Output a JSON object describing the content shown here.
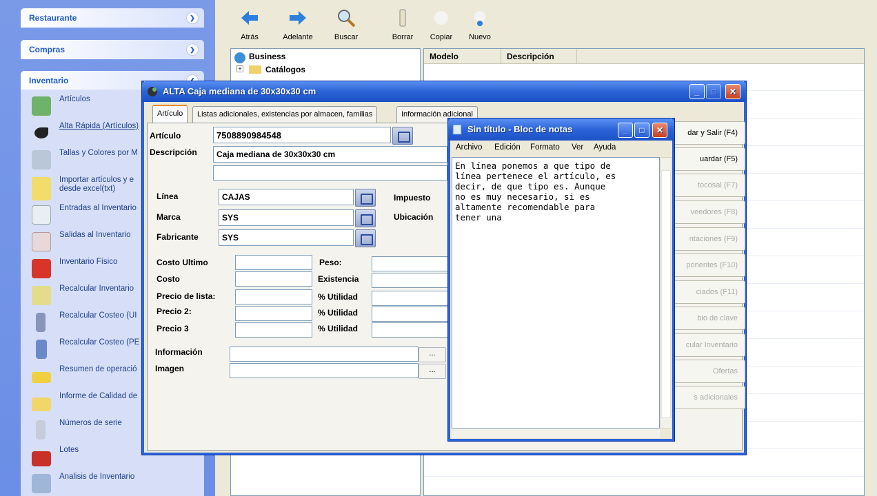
{
  "leftpane": {
    "sections": [
      {
        "title": "Restaurante"
      },
      {
        "title": "Compras"
      },
      {
        "title": "Inventario"
      }
    ],
    "inventario_items": [
      {
        "label": "Artículos"
      },
      {
        "label": "Alta Rápida (Artículos)"
      },
      {
        "label": "Tallas y Colores por M"
      },
      {
        "label": "Importar artículos y e desde excel(txt)"
      },
      {
        "label": "Entradas al Inventario"
      },
      {
        "label": "Salidas al Inventario"
      },
      {
        "label": "Inventario Físico"
      },
      {
        "label": "Recalcular Inventario"
      },
      {
        "label": "Recalcular Costeo (UI"
      },
      {
        "label": "Recalcular Costeo (PE"
      },
      {
        "label": "Resumen de operació"
      },
      {
        "label": "Informe de Calidad de"
      },
      {
        "label": "Números de serie"
      },
      {
        "label": "Lotes"
      },
      {
        "label": "Analisis de Inventario"
      }
    ]
  },
  "toolbar": {
    "back": "Atrás",
    "forward": "Adelante",
    "search": "Buscar",
    "delete": "Borrar",
    "copy": "Copiar",
    "new": "Nuevo"
  },
  "tree": {
    "root": "Business",
    "child": "Catálogos"
  },
  "listview": {
    "col_model": "Modelo",
    "col_desc": "Descripción"
  },
  "dialog": {
    "title": "ALTA Caja mediana de 30x30x30 cm",
    "tabs": [
      "Artículo",
      "Listas adicionales, existencias por almacen, familias",
      "Información adicional"
    ],
    "labels": {
      "articulo": "Artículo",
      "descripcion": "Descripción",
      "linea": "Línea",
      "marca": "Marca",
      "fabricante": "Fabricante",
      "impuesto": "Impuesto",
      "ubicacion": "Ubicación",
      "costo_ultimo": "Costo Ultimo",
      "costo": "Costo",
      "precio_lista": "Precio de lista:",
      "precio2": "Precio 2:",
      "precio3": "Precio 3",
      "peso": "Peso:",
      "existencia": "Existencia",
      "utilidad1": "% Utilidad",
      "utilidad2": "% Utilidad",
      "utilidad3": "% Utilidad",
      "informacion": "Información",
      "imagen": "Imagen"
    },
    "values": {
      "articulo": "7508890984548",
      "descripcion": "Caja mediana de 30x30x30 cm",
      "linea": "CAJAS",
      "marca": "SYS",
      "fabricante": "SYS"
    },
    "dots": "...",
    "side_buttons": [
      {
        "label": "dar y Salir (F4)",
        "enabled": true
      },
      {
        "label": "uardar (F5)",
        "enabled": true
      },
      {
        "label": "tocosal (F7)",
        "enabled": false
      },
      {
        "label": "veedores (F8)",
        "enabled": false
      },
      {
        "label": "ntaciones (F9)",
        "enabled": false
      },
      {
        "label": "ponentes (F10)",
        "enabled": false
      },
      {
        "label": "ciados (F11)",
        "enabled": false
      },
      {
        "label": "bio de clave",
        "enabled": false
      },
      {
        "label": "cular Inventario",
        "enabled": false
      },
      {
        "label": "Ofertas",
        "enabled": false
      },
      {
        "label": "s adicionales",
        "enabled": false
      }
    ]
  },
  "notepad": {
    "title": "Sin título - Bloc de notas",
    "menu": [
      "Archivo",
      "Edición",
      "Formato",
      "Ver",
      "Ayuda"
    ],
    "text": "En línea ponemos a que tipo de\nlínea pertenece el artículo, es\ndecir, de que tipo es. Aunque\nno es muy necesario, si es\naltamente recomendable para\ntener una"
  }
}
